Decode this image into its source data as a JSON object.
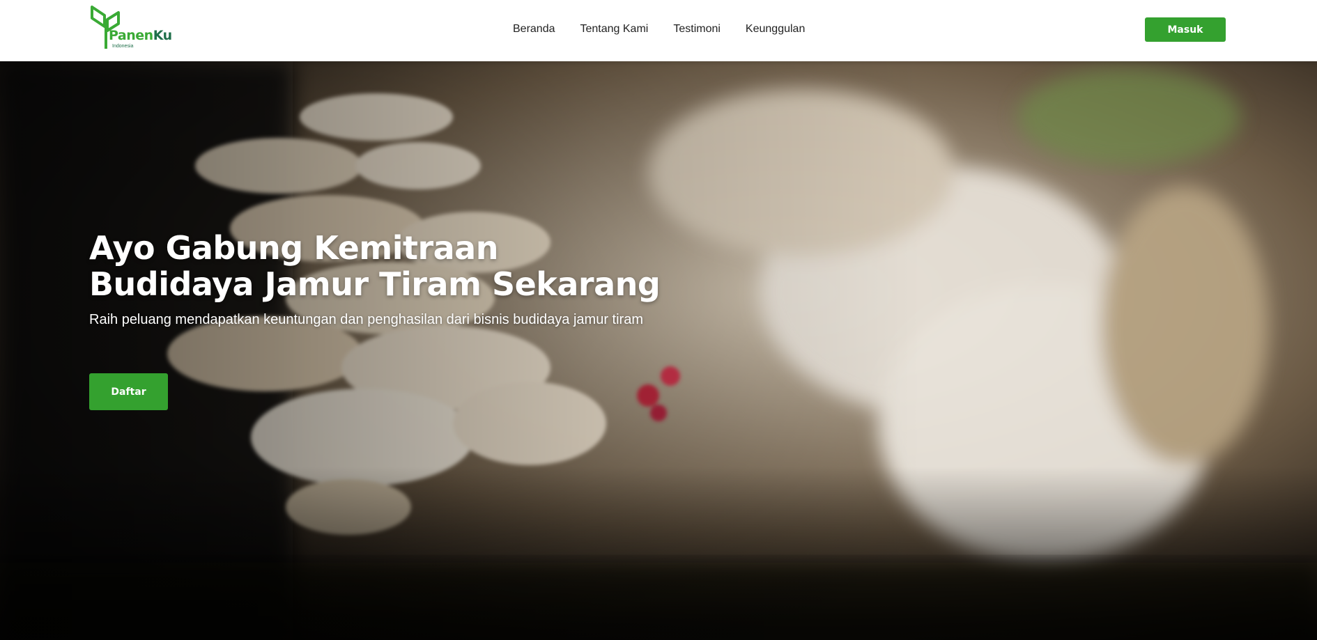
{
  "brand": {
    "name_part1": "Panen",
    "name_part2": "Ku",
    "subtitle": "Indonesia",
    "green": "#3aaa35",
    "dark_green": "#1f6f4a"
  },
  "nav": {
    "links": [
      {
        "label": "Beranda"
      },
      {
        "label": "Tentang Kami"
      },
      {
        "label": "Testimoni"
      },
      {
        "label": "Keunggulan"
      }
    ],
    "login_label": "Masuk"
  },
  "hero": {
    "title_line1": "Ayo Gabung Kemitraan",
    "title_line2": "Budidaya Jamur Tiram Sekarang",
    "subtitle": "Raih peluang mendapatkan keuntungan dan penghasilan dari bisnis budidaya jamur tiram",
    "cta_label": "Daftar",
    "background_image": "oyster-mushroom-photo"
  },
  "colors": {
    "accent": "#34a12f",
    "nav_text": "#222222",
    "hero_text": "#ffffff"
  }
}
